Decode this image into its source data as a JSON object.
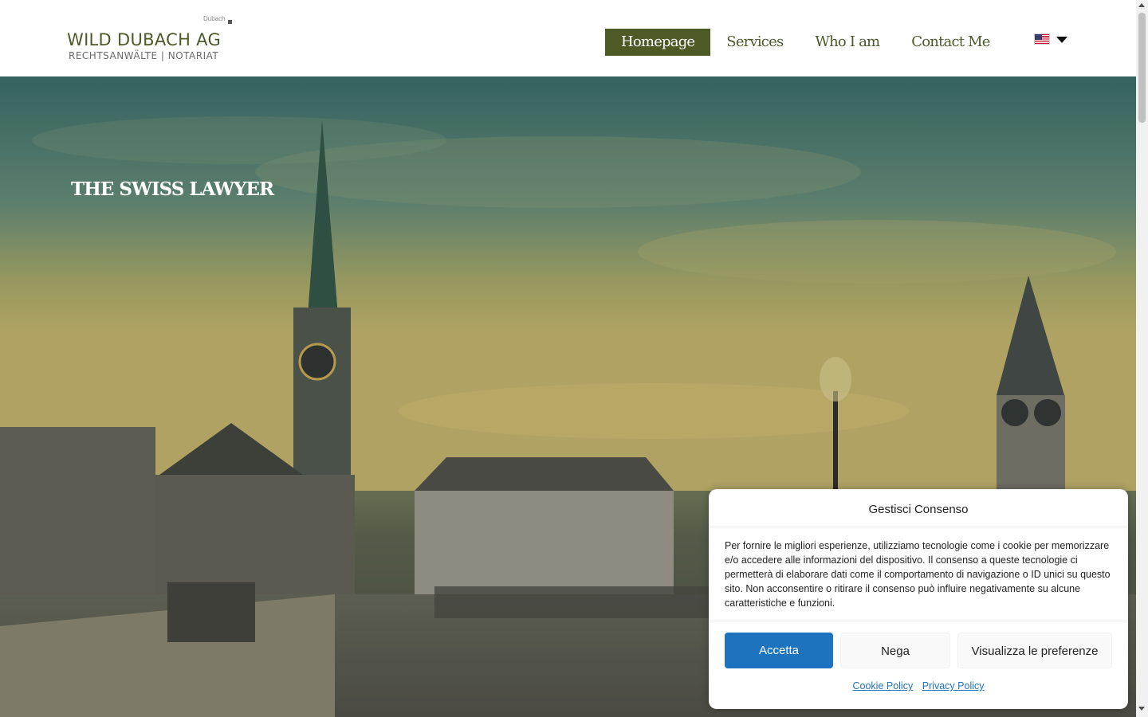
{
  "logo": {
    "small_text": "Dubach",
    "main_text": "WILD DUBACH AG",
    "sub_text": "RECHTSANWÄLTE | NOTARIAT"
  },
  "nav": {
    "items": [
      {
        "label": "Homepage",
        "active": true
      },
      {
        "label": "Services"
      },
      {
        "label": "Who I am"
      },
      {
        "label": "Contact Me"
      }
    ]
  },
  "language": {
    "flag": "us-flag-icon"
  },
  "hero": {
    "title": "THE SWISS LAWYER"
  },
  "consent": {
    "title": "Gestisci Consenso",
    "text": "Per fornire le migliori esperienze, utilizziamo tecnologie come i cookie per memorizzare e/o accedere alle informazioni del dispositivo. Il consenso a queste tecnologie ci permetterà di elaborare dati come il comportamento di navigazione o ID unici su questo sito. Non acconsentire o ritirare il consenso può influire negativamente su alcune caratteristiche e funzioni.",
    "accept_label": "Accetta",
    "deny_label": "Nega",
    "prefs_label": "Visualizza le preferenze",
    "cookie_policy_label": "Cookie Policy",
    "privacy_policy_label": "Privacy Policy"
  },
  "colors": {
    "brand": "#4d5a26",
    "accept_button": "#1e73be"
  }
}
